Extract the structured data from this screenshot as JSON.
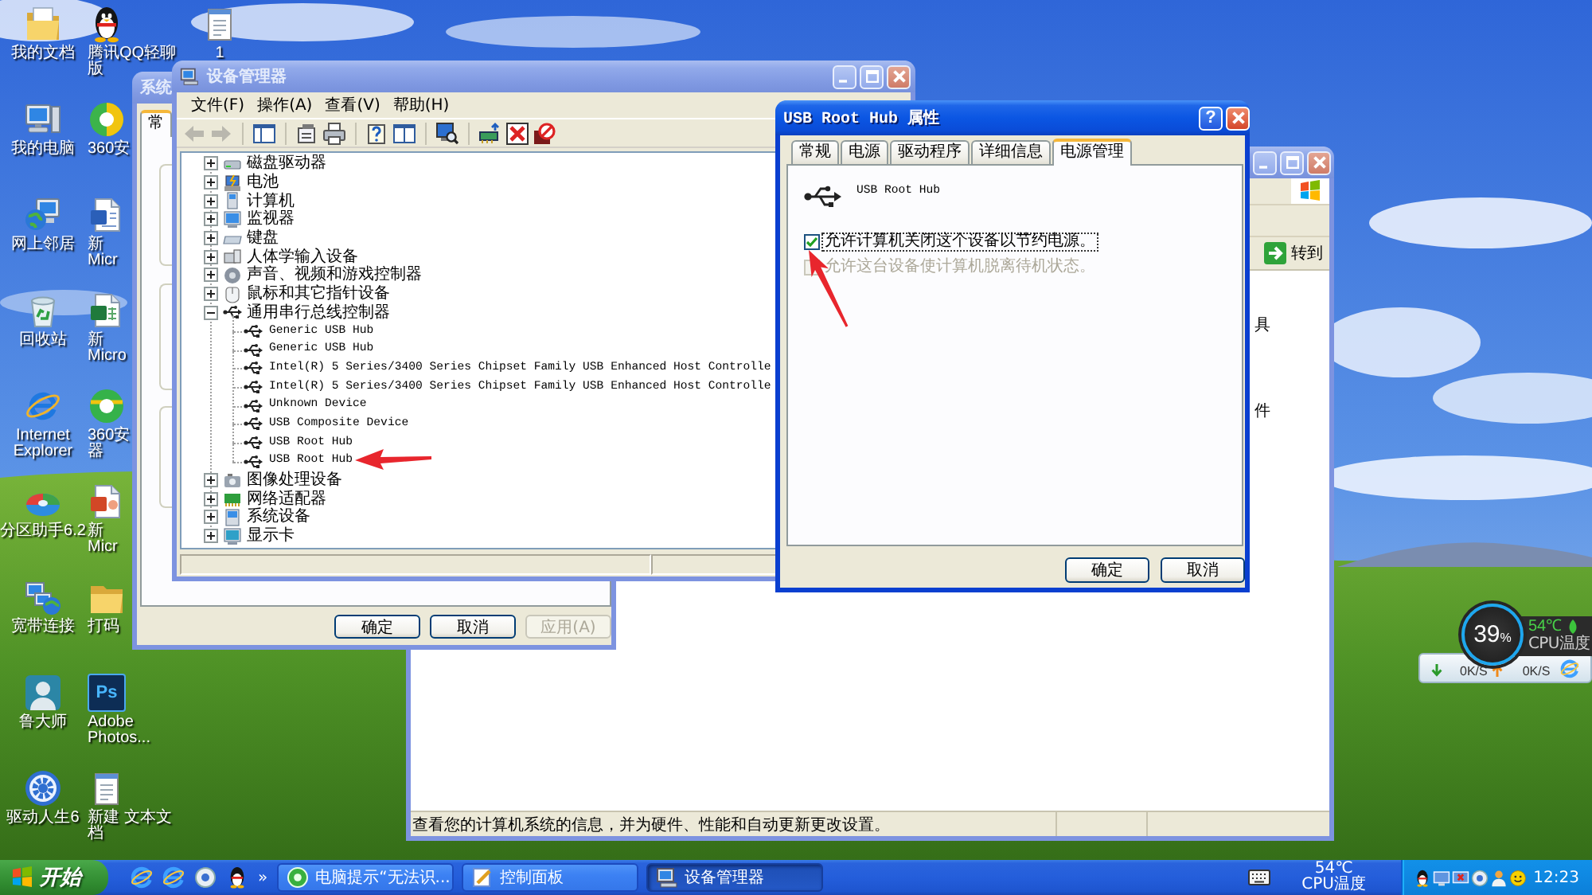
{
  "desktop": {
    "columns": [
      [
        {
          "lines": [
            "我的文档"
          ],
          "kind": "documents"
        },
        {
          "lines": [
            "我的电脑"
          ],
          "kind": "computer"
        },
        {
          "lines": [
            "网上邻居"
          ],
          "kind": "network"
        },
        {
          "lines": [
            "回收站"
          ],
          "kind": "recycle"
        },
        {
          "lines": [
            "Internet",
            "Explorer"
          ],
          "kind": "browser"
        },
        {
          "lines": [
            "分区助手6.2"
          ],
          "kind": "partition"
        },
        {
          "lines": [
            "宽带连接"
          ],
          "kind": "broadband"
        },
        {
          "lines": [
            "鲁大师"
          ],
          "kind": "person-tile"
        },
        {
          "lines": [
            "驱动人生6"
          ],
          "kind": "gear"
        }
      ],
      [
        {
          "lines": [
            "腾讯QQ轻聊",
            "版"
          ],
          "kind": "penguin"
        },
        {
          "lines": [
            "360安"
          ],
          "kind": "shield"
        },
        {
          "lines": [
            "新",
            "Micr"
          ],
          "kind": "word"
        },
        {
          "lines": [
            "新",
            "Micro"
          ],
          "kind": "sheet"
        },
        {
          "lines": [
            "360安",
            "器"
          ],
          "kind": "globe"
        },
        {
          "lines": [
            "新",
            "Micr"
          ],
          "kind": "slides"
        },
        {
          "lines": [
            "打码"
          ],
          "kind": "folder"
        },
        {
          "lines": [
            "Adobe",
            "Photos..."
          ],
          "kind": "letter-tile",
          "tile_text": "Ps"
        },
        {
          "lines": [
            "新建 文本文",
            "档"
          ],
          "kind": "notepad"
        }
      ],
      [
        {
          "lines": [
            "1"
          ],
          "kind": "notepad"
        }
      ]
    ]
  },
  "control_panel": {
    "go_button": "转到",
    "fragments": [
      "具",
      "件"
    ],
    "status_text": "查看您的计算机系统的信息，并为硬件、性能和自动更新更改设置。"
  },
  "system_properties": {
    "title": "系统",
    "tabs": [
      {
        "label": "常",
        "selected": true
      }
    ],
    "buttons": [
      {
        "label": "确定",
        "disabled": false
      },
      {
        "label": "取消",
        "disabled": false
      },
      {
        "label": "应用(A)",
        "disabled": true
      }
    ]
  },
  "device_manager": {
    "title": "设备管理器",
    "menus": [
      "文件(F)",
      "操作(A)",
      "查看(V)",
      "帮助(H)"
    ],
    "toolbar": [
      [
        {
          "kind": "back",
          "disabled": true
        },
        {
          "kind": "forward",
          "disabled": true
        }
      ],
      [
        {
          "kind": "tree-pane",
          "disabled": false
        }
      ],
      [
        {
          "kind": "properties",
          "disabled": false
        },
        {
          "kind": "print",
          "disabled": false
        }
      ],
      [
        {
          "kind": "help",
          "disabled": false
        },
        {
          "kind": "view-pane",
          "disabled": false
        }
      ],
      [
        {
          "kind": "scan",
          "disabled": false
        }
      ],
      [
        {
          "kind": "update",
          "disabled": false
        },
        {
          "kind": "disable",
          "disabled": false
        },
        {
          "kind": "uninstall",
          "disabled": false
        }
      ]
    ],
    "tree": [
      {
        "label": "磁盘驱动器",
        "kind": "disk",
        "expanded": false
      },
      {
        "label": "电池",
        "kind": "battery",
        "expanded": false
      },
      {
        "label": "计算机",
        "kind": "computer",
        "expanded": false
      },
      {
        "label": "监视器",
        "kind": "monitor",
        "expanded": false
      },
      {
        "label": "键盘",
        "kind": "keyboard",
        "expanded": false
      },
      {
        "label": "人体学输入设备",
        "kind": "hid",
        "expanded": false
      },
      {
        "label": "声音、视频和游戏控制器",
        "kind": "sound",
        "expanded": false
      },
      {
        "label": "鼠标和其它指针设备",
        "kind": "mouse",
        "expanded": false
      },
      {
        "label": "通用串行总线控制器",
        "kind": "usb",
        "expanded": true,
        "children": [
          {
            "label": "Generic USB Hub",
            "kind": "usb"
          },
          {
            "label": "Generic USB Hub",
            "kind": "usb"
          },
          {
            "label": "Intel(R) 5 Series/3400 Series Chipset Family USB Enhanced Host Controlle",
            "kind": "usb"
          },
          {
            "label": "Intel(R) 5 Series/3400 Series Chipset Family USB Enhanced Host Controlle",
            "kind": "usb"
          },
          {
            "label": "Unknown Device",
            "kind": "usb"
          },
          {
            "label": "USB Composite Device",
            "kind": "usb"
          },
          {
            "label": "USB Root Hub",
            "kind": "usb"
          },
          {
            "label": "USB Root Hub",
            "kind": "usb"
          }
        ]
      },
      {
        "label": "图像处理设备",
        "kind": "imaging",
        "expanded": false
      },
      {
        "label": "网络适配器",
        "kind": "network",
        "expanded": false
      },
      {
        "label": "系统设备",
        "kind": "system",
        "expanded": false
      },
      {
        "label": "显示卡",
        "kind": "display",
        "expanded": false
      }
    ]
  },
  "properties_dialog": {
    "title": "USB Root Hub 属性",
    "help_button": "?",
    "tabs": [
      {
        "label": "常规",
        "selected": false
      },
      {
        "label": "电源",
        "selected": false
      },
      {
        "label": "驱动程序",
        "selected": false
      },
      {
        "label": "详细信息",
        "selected": false
      },
      {
        "label": "电源管理",
        "selected": true
      }
    ],
    "device_name": "USB Root Hub",
    "options": [
      {
        "label": "允许计算机关闭这个设备以节约电源。",
        "checked": true,
        "disabled": false,
        "focused": true
      },
      {
        "label": "允许这台设备使计算机脱离待机状态。",
        "checked": false,
        "disabled": true,
        "focused": false
      }
    ],
    "buttons": [
      {
        "label": "确定"
      },
      {
        "label": "取消"
      }
    ]
  },
  "cpu_widget": {
    "usage": "39",
    "usage_unit": "%",
    "temperature": "54℃",
    "temperature_label": "CPU温度",
    "download": "0K/S",
    "upload": "0K/S"
  },
  "taskbar": {
    "start": "开始",
    "quick_launch": [
      {
        "kind": "browser"
      },
      {
        "kind": "browser"
      },
      {
        "kind": "media"
      },
      {
        "kind": "penguin"
      }
    ],
    "more": "»",
    "tasks": [
      {
        "label": "电脑提示“无法识...",
        "kind": "tip",
        "selected": false
      },
      {
        "label": "控制面板",
        "kind": "control-panel",
        "selected": false
      },
      {
        "label": "设备管理器",
        "kind": "device-manager",
        "selected": true
      }
    ],
    "temperature": "54℃",
    "temperature_label": "CPU温度",
    "tray": [
      {
        "kind": "penguin"
      },
      {
        "kind": "monitor"
      },
      {
        "kind": "monitor-error"
      },
      {
        "kind": "disc"
      },
      {
        "kind": "person"
      },
      {
        "kind": "smiley"
      }
    ],
    "clock": "12:23"
  }
}
